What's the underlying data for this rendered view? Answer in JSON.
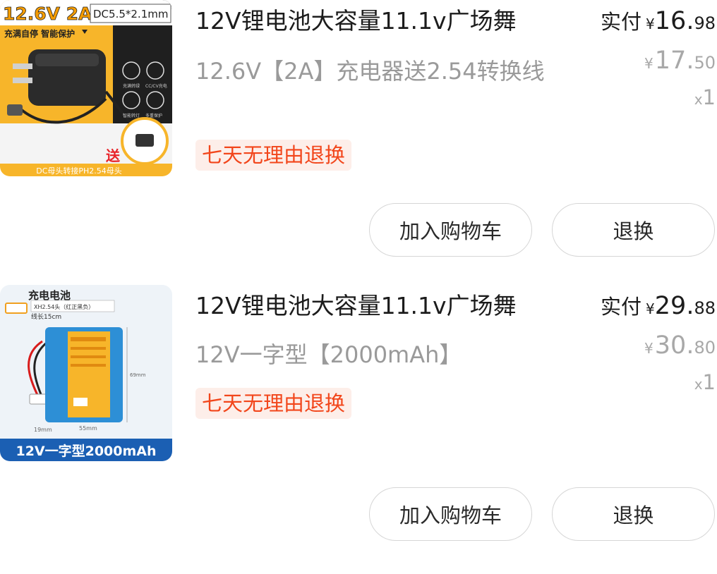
{
  "items": [
    {
      "title": "12V锂电池大容量11.1v广场舞",
      "spec": "12.6V【2A】充电器送2.54转换线",
      "badge": "七天无理由退换",
      "paid_label": "实付",
      "currency": "¥",
      "paid_int": "16.",
      "paid_dec": "98",
      "orig_int": "17.",
      "orig_dec": "50",
      "qty_prefix": "x",
      "qty": "1",
      "thumb": {
        "heading": "12.6V 2A",
        "sub": "DC5.5*2.1mm",
        "tagline": "充满自停 智能保护",
        "gift": "送",
        "footer": "DC母头转接PH2.54母头",
        "feature_labels": [
          "充满转绿",
          "CC/CV充电",
          "智能转灯",
          "多重保护"
        ]
      },
      "buttons": {
        "cart": "加入购物车",
        "return": "退换"
      }
    },
    {
      "title": "12V锂电池大容量11.1v广场舞",
      "spec": "12V一字型【2000mAh】",
      "badge": "七天无理由退换",
      "paid_label": "实付",
      "currency": "¥",
      "paid_int": "29.",
      "paid_dec": "88",
      "orig_int": "30.",
      "orig_dec": "80",
      "qty_prefix": "x",
      "qty": "1",
      "thumb": {
        "heading": "充电电池",
        "connector": "XH2.54头（红正黑负）",
        "wire": "线长15cm",
        "dim_w": "55mm",
        "dim_d": "19mm",
        "dim_h": "69mm",
        "footer": "12V一字型2000mAh"
      },
      "buttons": {
        "cart": "加入购物车",
        "return": "退换"
      }
    }
  ],
  "colors": {
    "badge_text": "#f2461b",
    "badge_bg": "#fdeee9",
    "muted": "#9a9a9a",
    "text": "#1c1c1c",
    "button_border": "#d6d6d6"
  }
}
